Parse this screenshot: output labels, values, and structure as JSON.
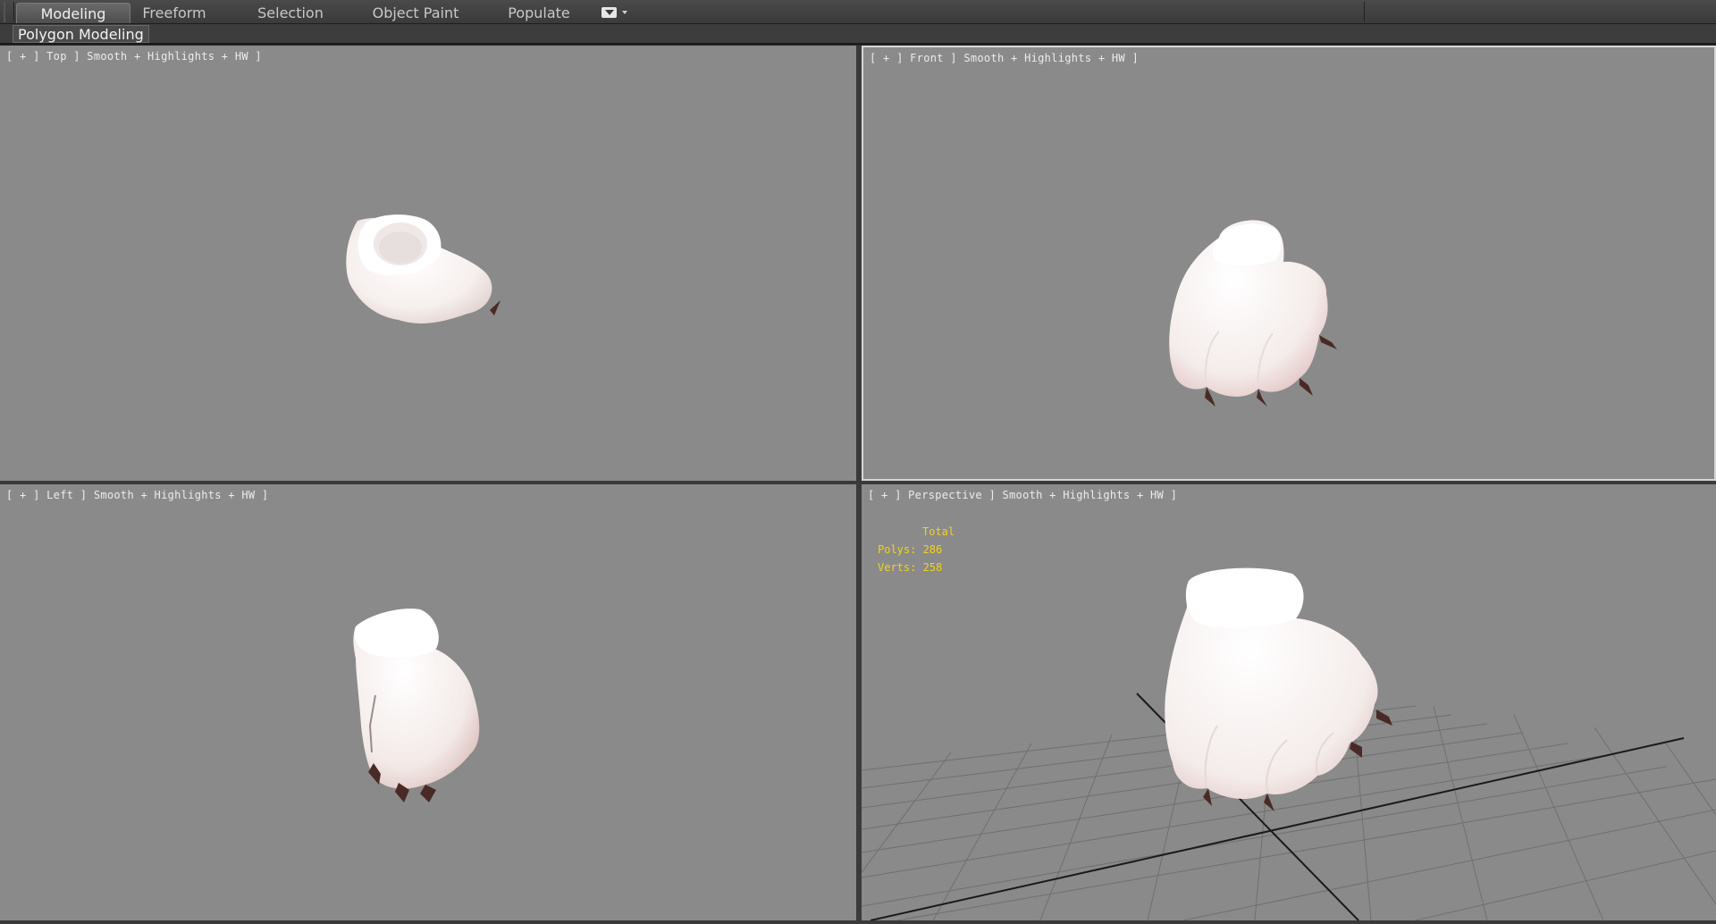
{
  "ribbon": {
    "tabs": [
      {
        "label": "Modeling",
        "active": true
      },
      {
        "label": "Freeform",
        "active": false
      },
      {
        "label": "Selection",
        "active": false
      },
      {
        "label": "Object Paint",
        "active": false
      },
      {
        "label": "Populate",
        "active": false
      }
    ],
    "toggle_icon": "ribbon-minimize-icon",
    "panel_label": "Polygon Modeling"
  },
  "viewports": {
    "top": {
      "label": "[ + ] Top ] Smooth + Highlights + HW ]"
    },
    "front": {
      "label": "[ + ] Front ] Smooth + Highlights + HW ]"
    },
    "left": {
      "label": "[ + ] Left ] Smooth + Highlights + HW ]"
    },
    "perspective": {
      "label": "[ + ] Perspective ] Smooth + Highlights + HW ]",
      "stats": {
        "total": "Total",
        "polys": "Polys: 286",
        "verts": "Verts: 258"
      }
    }
  },
  "colors": {
    "viewport_bg": "#8a8a8a",
    "stats_text": "#f3d21c",
    "model_fill": "#f8f3f1",
    "claw": "#4a2a26",
    "grid": "#6f6f6f",
    "grid_axis": "#1a1a1a"
  }
}
